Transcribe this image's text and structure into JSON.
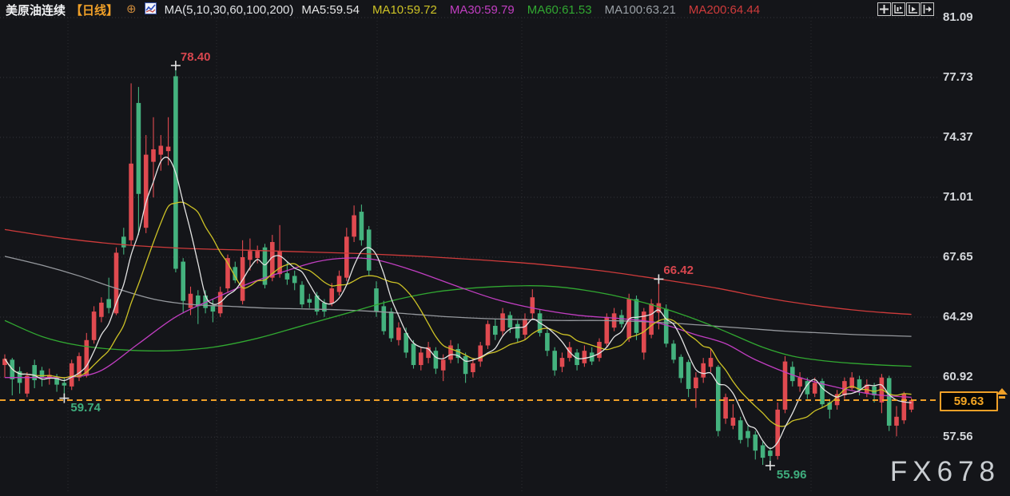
{
  "header": {
    "symbol": "美原油连续",
    "period": "【日线】",
    "add_icon": "⊕",
    "ma_settings": "MA(5,10,30,60,100,200)",
    "ma_readouts": [
      {
        "label": "MA5",
        "value": "59.54",
        "color": "#e6e6e6"
      },
      {
        "label": "MA10",
        "value": "59.72",
        "color": "#cdc226"
      },
      {
        "label": "MA30",
        "value": "59.79",
        "color": "#c13ec1"
      },
      {
        "label": "MA60",
        "value": "61.53",
        "color": "#31a831"
      },
      {
        "label": "MA100",
        "value": "63.21",
        "color": "#9aa0a6"
      },
      {
        "label": "MA200",
        "value": "64.44",
        "color": "#cf3b3b"
      }
    ]
  },
  "toolbar": {
    "buttons": [
      "pan",
      "fit-scale",
      "play-latest",
      "jump-to-latest"
    ]
  },
  "y_axis": {
    "ticks": [
      {
        "label": "81.09",
        "price": 81.09
      },
      {
        "label": "77.73",
        "price": 77.73
      },
      {
        "label": "74.37",
        "price": 74.37
      },
      {
        "label": "71.01",
        "price": 71.01
      },
      {
        "label": "67.65",
        "price": 67.65
      },
      {
        "label": "64.29",
        "price": 64.29
      },
      {
        "label": "60.92",
        "price": 60.92
      },
      {
        "label": "57.56",
        "price": 57.56
      }
    ]
  },
  "last_price": {
    "value": "59.63",
    "price": 59.63
  },
  "watermark": "FX678",
  "colors": {
    "background": "#141519",
    "up_candle": "#e04a50",
    "down_candle": "#44b27e",
    "grid": "#33353a",
    "axis_text": "#d6d9dd",
    "accent_orange": "#f0a028",
    "annotation_red": "#d8464e",
    "annotation_green": "#3fae7e",
    "cross_marker": "#e3e3e3"
  },
  "chart_data": {
    "type": "candlestick",
    "title": "美原油连续 日线 (US Crude Oil Continuous, Daily)",
    "y_ticks": [
      81.09,
      77.73,
      74.37,
      71.01,
      67.65,
      64.29,
      60.92,
      57.56
    ],
    "y_range": [
      55.0,
      81.5
    ],
    "grid": true,
    "v_gridlines": [
      85,
      271,
      472,
      653,
      834,
      1015
    ],
    "candles_format": [
      "open",
      "high",
      "low",
      "close"
    ],
    "candles": [
      [
        61.6,
        62.2,
        60.9,
        61.95
      ],
      [
        61.9,
        62,
        59.9,
        60.8
      ],
      [
        61.25,
        61.5,
        60,
        60.6
      ],
      [
        60,
        61.2,
        59.8,
        61
      ],
      [
        61.6,
        61.9,
        60.3,
        60.75
      ],
      [
        61.3,
        61.5,
        60.4,
        60.9
      ],
      [
        60.9,
        61.4,
        60.5,
        61.05
      ],
      [
        60.9,
        61.1,
        60.1,
        60.5
      ],
      [
        60.6,
        60.9,
        59.74,
        60.45
      ],
      [
        60.4,
        61.9,
        60.2,
        61.7
      ],
      [
        60.9,
        62.3,
        60.7,
        62.1
      ],
      [
        61,
        63.4,
        60.9,
        63
      ],
      [
        63,
        64.9,
        62.8,
        64.6
      ],
      [
        64.3,
        65.4,
        64,
        65.1
      ],
      [
        65.3,
        66.5,
        64.5,
        64.8
      ],
      [
        64.5,
        68.2,
        64.4,
        67.9
      ],
      [
        68.8,
        69.3,
        67.8,
        68.2
      ],
      [
        68.6,
        77.4,
        68.3,
        72.9
      ],
      [
        76.3,
        77.2,
        68.9,
        71.2
      ],
      [
        69.3,
        74.5,
        69,
        73.4
      ],
      [
        73,
        75.5,
        71,
        73.7
      ],
      [
        73.4,
        74.5,
        72.5,
        73.9
      ],
      [
        73.6,
        75.5,
        72.8,
        73.85
      ],
      [
        77.8,
        78.4,
        66.8,
        67
      ],
      [
        67.4,
        67.6,
        64.5,
        65.2
      ],
      [
        64.8,
        66,
        64.4,
        65.6
      ],
      [
        65.5,
        65.8,
        63.9,
        64.9
      ],
      [
        65.5,
        65.8,
        64.5,
        64.8
      ],
      [
        64.9,
        65.3,
        64,
        64.6
      ],
      [
        64.5,
        66,
        64.3,
        65.7
      ],
      [
        65.9,
        67.8,
        65.7,
        67.6
      ],
      [
        67.1,
        67.4,
        66.2,
        66.35
      ],
      [
        65.2,
        68.6,
        65,
        67.65
      ],
      [
        67.5,
        68.7,
        66.9,
        68
      ],
      [
        67.6,
        68.3,
        67.3,
        68
      ],
      [
        68.2,
        68.4,
        65.9,
        66.1
      ],
      [
        66.5,
        68.9,
        66.3,
        68.5
      ],
      [
        66.7,
        69.45,
        66.5,
        68
      ],
      [
        66.75,
        67.4,
        66.1,
        66.4
      ],
      [
        66.6,
        66.9,
        65.8,
        66.2
      ],
      [
        66.1,
        66.3,
        64.8,
        65
      ],
      [
        65.3,
        65.6,
        64.8,
        65.1
      ],
      [
        65.5,
        65.7,
        64.4,
        64.6
      ],
      [
        65.1,
        65.3,
        64.3,
        64.6
      ],
      [
        65.06,
        66.2,
        64.9,
        65.9
      ],
      [
        65.7,
        66.9,
        65.5,
        66.6
      ],
      [
        66.5,
        69.3,
        66.3,
        68.8
      ],
      [
        68.8,
        70.55,
        68.5,
        70
      ],
      [
        70.2,
        70.6,
        68.3,
        68.6
      ],
      [
        69.2,
        69.4,
        66.6,
        66.9
      ],
      [
        65.9,
        66.3,
        64.3,
        64.6
      ],
      [
        64.9,
        65.2,
        63.3,
        63.5
      ],
      [
        64.6,
        64.8,
        62.9,
        63.1
      ],
      [
        63,
        64,
        62.7,
        63.7
      ],
      [
        63.4,
        63.7,
        62,
        62.3
      ],
      [
        62.8,
        63,
        61.4,
        61.6
      ],
      [
        61.6,
        62.6,
        61.3,
        62.3
      ],
      [
        62,
        62.9,
        61.7,
        62.6
      ],
      [
        62.4,
        62.6,
        61.1,
        61.4
      ],
      [
        61.3,
        62.2,
        60.7,
        61.9
      ],
      [
        61.9,
        63,
        61.7,
        62.7
      ],
      [
        62.5,
        62.8,
        61.7,
        62
      ],
      [
        62.1,
        62.3,
        60.6,
        61.1
      ],
      [
        61.2,
        62,
        60.9,
        61.7
      ],
      [
        61.8,
        62.9,
        61.5,
        62.7
      ],
      [
        62.7,
        64.1,
        62.5,
        63.9
      ],
      [
        63.8,
        64.2,
        63,
        63.3
      ],
      [
        63.5,
        64.8,
        63.2,
        64.5
      ],
      [
        64.4,
        64.6,
        63.4,
        63.7
      ],
      [
        63.9,
        64.1,
        62.9,
        63.1
      ],
      [
        63.3,
        64.5,
        63,
        64.2
      ],
      [
        64.5,
        65.85,
        64.2,
        65.4
      ],
      [
        64.5,
        64.7,
        63.2,
        63.4
      ],
      [
        63.4,
        63.6,
        62.1,
        62.4
      ],
      [
        62.4,
        62.6,
        61,
        61.3
      ],
      [
        61.5,
        62.3,
        61.2,
        62
      ],
      [
        62,
        62.9,
        61.8,
        62.6
      ],
      [
        62.3,
        62.5,
        61.3,
        61.6
      ],
      [
        61.7,
        62.7,
        61.5,
        62.4
      ],
      [
        62.3,
        62.6,
        61.6,
        61.8
      ],
      [
        62,
        63.1,
        61.8,
        62.9
      ],
      [
        62.8,
        64.5,
        62.6,
        64.3
      ],
      [
        63.7,
        64.8,
        63.5,
        64.5
      ],
      [
        64.4,
        64.7,
        63.7,
        63.9
      ],
      [
        63.1,
        65.6,
        62.9,
        65.3
      ],
      [
        65.3,
        65.5,
        63,
        63.4
      ],
      [
        62.3,
        64.8,
        61.9,
        64.6
      ],
      [
        63.3,
        65.3,
        63.1,
        65.05
      ],
      [
        64.54,
        66.42,
        63.6,
        65.07
      ],
      [
        64.75,
        65,
        62.6,
        62.8
      ],
      [
        62.8,
        63,
        61.7,
        61.9
      ],
      [
        62.06,
        62.2,
        60.6,
        60.87
      ],
      [
        61.77,
        61.9,
        59.8,
        60.26
      ],
      [
        60.3,
        61.2,
        59.2,
        60.9
      ],
      [
        60.9,
        62,
        60.6,
        61.7
      ],
      [
        61.5,
        62.5,
        61.2,
        62
      ],
      [
        61.5,
        61.6,
        57.6,
        57.9
      ],
      [
        58.6,
        60,
        58.3,
        59.8
      ],
      [
        58.2,
        59.4,
        58,
        58.65
      ],
      [
        58.5,
        58.7,
        57.2,
        57.4
      ],
      [
        57.9,
        58.2,
        57,
        57.5
      ],
      [
        57.7,
        57.9,
        56.3,
        56.8
      ],
      [
        57.1,
        57.3,
        56,
        56.4
      ],
      [
        56.8,
        57,
        55.96,
        56.5
      ],
      [
        56.5,
        59.5,
        56.3,
        59.1
      ],
      [
        59.1,
        62.1,
        58.9,
        61.8
      ],
      [
        61.5,
        61.8,
        60.4,
        60.7
      ],
      [
        60.4,
        61.2,
        60.1,
        60.9
      ],
      [
        60.7,
        60.9,
        59.7,
        59.96
      ],
      [
        60,
        60.9,
        59.8,
        60.6
      ],
      [
        60.7,
        60.85,
        59.2,
        59.4
      ],
      [
        59.5,
        59.7,
        58.6,
        59.1
      ],
      [
        59.35,
        60.2,
        59.1,
        59.97
      ],
      [
        59.9,
        60.9,
        59.7,
        60.7
      ],
      [
        60.3,
        61.2,
        60.2,
        60.9
      ],
      [
        60.8,
        61,
        59.9,
        60.2
      ],
      [
        60,
        60.8,
        59.8,
        60.5
      ],
      [
        60.4,
        60.6,
        59.5,
        59.9
      ],
      [
        59.5,
        61.1,
        58.9,
        60.9
      ],
      [
        60.87,
        61,
        57.9,
        58.2
      ],
      [
        58.2,
        59.3,
        57.6,
        58.7
      ],
      [
        58.5,
        60.1,
        58.3,
        59.97
      ],
      [
        59.1,
        59.75,
        58.95,
        59.63
      ]
    ],
    "annotations": [
      {
        "text": "78.40",
        "index": 23,
        "price": 78.4,
        "kind": "high",
        "color": "#d8464e"
      },
      {
        "text": "66.42",
        "index": 88,
        "price": 66.42,
        "kind": "high",
        "color": "#d8464e"
      },
      {
        "text": "59.74",
        "index": 8,
        "price": 59.74,
        "kind": "low",
        "color": "#3fae7e"
      },
      {
        "text": "55.96",
        "index": 103,
        "price": 55.96,
        "kind": "low",
        "color": "#3fae7e"
      }
    ],
    "last_price_line": {
      "price": 59.63,
      "style": "dashed",
      "color": "#f0a028"
    },
    "ma_lines": [
      {
        "name": "MA5",
        "period": 5,
        "color": "#e3e3e3",
        "derive": "sma_of_closes"
      },
      {
        "name": "MA10",
        "period": 10,
        "color": "#cdc226",
        "derive": "sma_of_closes"
      },
      {
        "name": "MA30",
        "period": 30,
        "color": "#c13ec1",
        "points": [
          [
            0,
            60.9
          ],
          [
            6,
            60.9
          ],
          [
            9,
            60.92
          ],
          [
            13,
            61.3
          ],
          [
            18,
            62.8
          ],
          [
            23,
            64.3
          ],
          [
            28,
            65.3
          ],
          [
            33,
            66.2
          ],
          [
            38,
            66.9
          ],
          [
            42,
            67.4
          ],
          [
            46,
            67.6
          ],
          [
            50,
            67.5
          ],
          [
            55,
            66.9
          ],
          [
            61,
            66.0
          ],
          [
            66,
            65.3
          ],
          [
            71,
            64.8
          ],
          [
            77,
            64.4
          ],
          [
            83,
            64.2
          ],
          [
            88,
            63.95
          ],
          [
            93,
            63.3
          ],
          [
            97,
            62.8
          ],
          [
            101,
            61.9
          ],
          [
            107,
            60.9
          ],
          [
            112,
            60.35
          ],
          [
            117,
            59.95
          ],
          [
            122,
            59.79
          ]
        ]
      },
      {
        "name": "MA60",
        "period": 60,
        "color": "#31a831",
        "points": [
          [
            0,
            64.1
          ],
          [
            5,
            63.2
          ],
          [
            10,
            62.7
          ],
          [
            16,
            62.45
          ],
          [
            22,
            62.4
          ],
          [
            28,
            62.6
          ],
          [
            34,
            63.1
          ],
          [
            40,
            63.8
          ],
          [
            46,
            64.5
          ],
          [
            52,
            65.2
          ],
          [
            58,
            65.7
          ],
          [
            64,
            65.95
          ],
          [
            70,
            66.05
          ],
          [
            74,
            66.0
          ],
          [
            78,
            65.8
          ],
          [
            82,
            65.5
          ],
          [
            86,
            65.1
          ],
          [
            90,
            64.6
          ],
          [
            94,
            64.0
          ],
          [
            98,
            63.3
          ],
          [
            102,
            62.6
          ],
          [
            106,
            62.1
          ],
          [
            110,
            61.85
          ],
          [
            114,
            61.7
          ],
          [
            118,
            61.6
          ],
          [
            122,
            61.53
          ]
        ]
      },
      {
        "name": "MA100",
        "period": 100,
        "color": "#96999e",
        "points": [
          [
            0,
            67.7
          ],
          [
            5,
            67.2
          ],
          [
            10,
            66.6
          ],
          [
            15,
            65.9
          ],
          [
            20,
            65.3
          ],
          [
            25,
            65.0
          ],
          [
            30,
            64.9
          ],
          [
            35,
            64.8
          ],
          [
            40,
            64.75
          ],
          [
            45,
            64.7
          ],
          [
            50,
            64.6
          ],
          [
            55,
            64.45
          ],
          [
            60,
            64.3
          ],
          [
            65,
            64.2
          ],
          [
            70,
            64.15
          ],
          [
            75,
            64.1
          ],
          [
            80,
            64.1
          ],
          [
            85,
            64.05
          ],
          [
            90,
            63.95
          ],
          [
            95,
            63.8
          ],
          [
            100,
            63.65
          ],
          [
            105,
            63.5
          ],
          [
            110,
            63.4
          ],
          [
            115,
            63.3
          ],
          [
            122,
            63.21
          ]
        ]
      },
      {
        "name": "MA200",
        "period": 200,
        "color": "#cf3b3b",
        "points": [
          [
            0,
            69.2
          ],
          [
            8,
            68.7
          ],
          [
            16,
            68.35
          ],
          [
            24,
            68.15
          ],
          [
            32,
            68.05
          ],
          [
            40,
            67.95
          ],
          [
            48,
            67.85
          ],
          [
            56,
            67.7
          ],
          [
            64,
            67.5
          ],
          [
            72,
            67.25
          ],
          [
            80,
            66.9
          ],
          [
            86,
            66.55
          ],
          [
            90,
            66.3
          ],
          [
            96,
            65.9
          ],
          [
            102,
            65.4
          ],
          [
            108,
            65.0
          ],
          [
            114,
            64.7
          ],
          [
            118,
            64.55
          ],
          [
            122,
            64.44
          ]
        ]
      }
    ]
  }
}
